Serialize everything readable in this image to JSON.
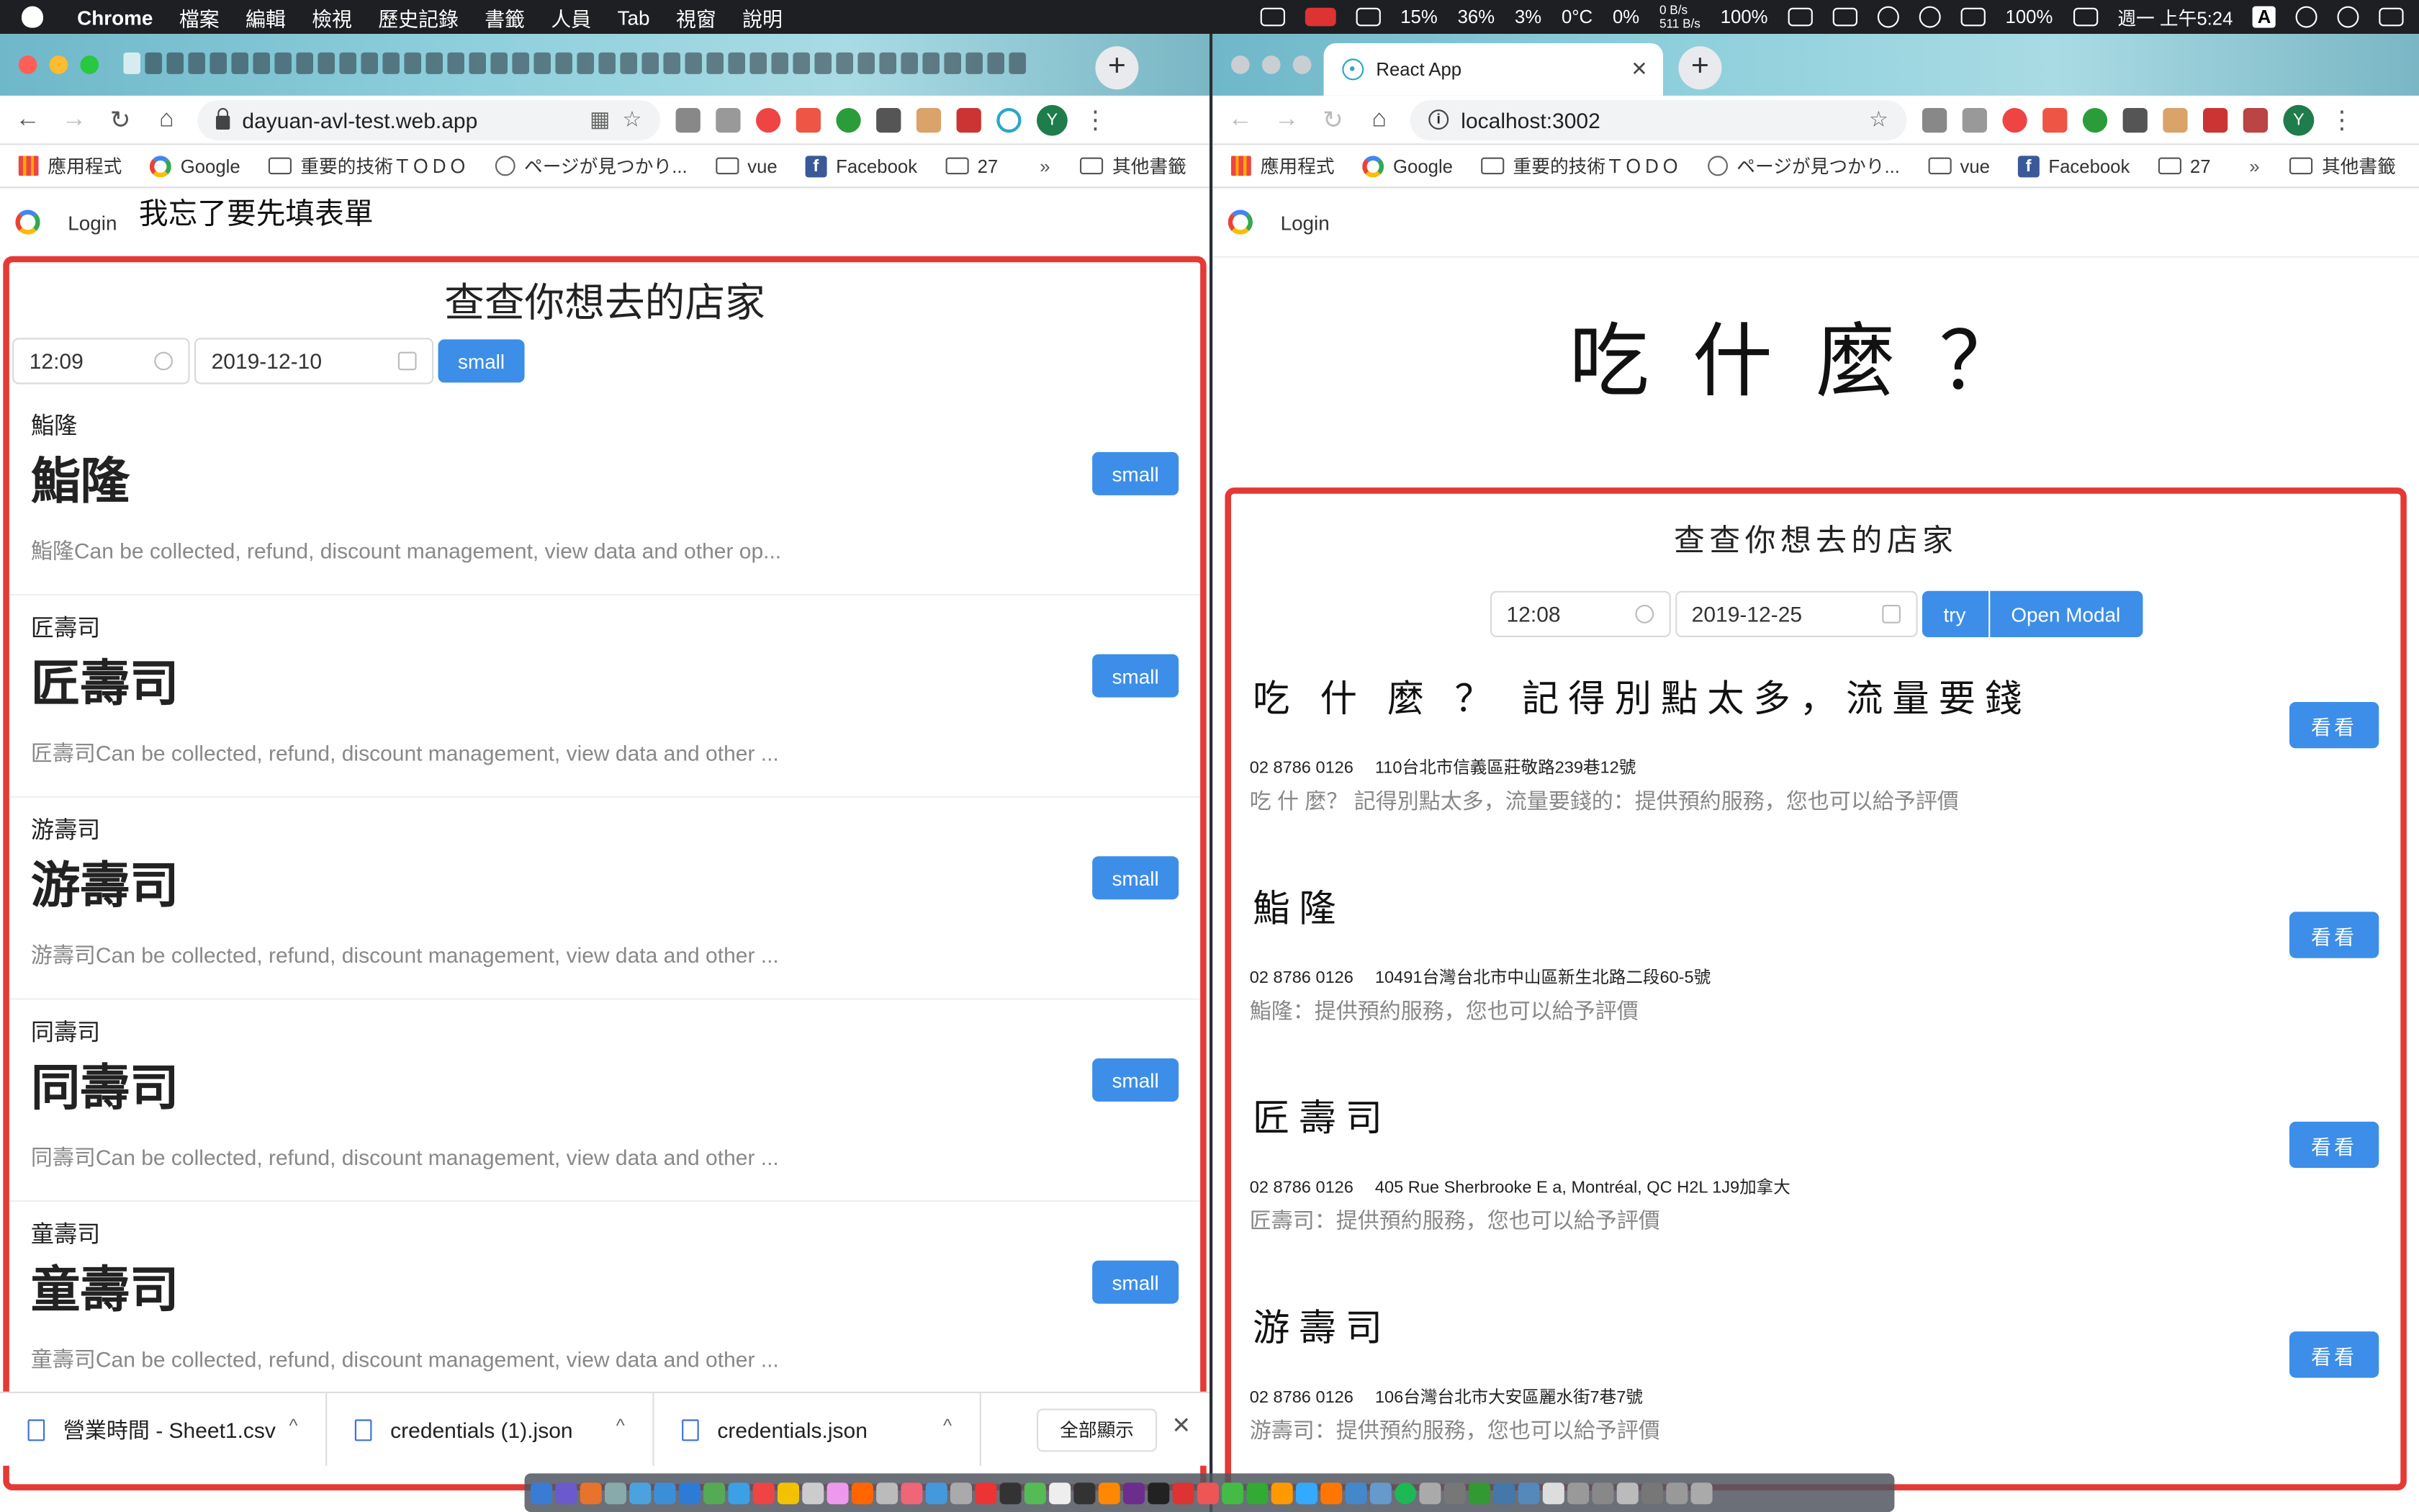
{
  "menubar": {
    "app": "Chrome",
    "items": [
      "檔案",
      "編輯",
      "檢視",
      "歷史記錄",
      "書籤",
      "人員",
      "Tab",
      "視窗",
      "說明"
    ],
    "status": [
      "15%",
      "36%",
      "3%",
      "0°C",
      "0%",
      "0 B/s",
      "511 B/s",
      "100%",
      "100%",
      "週一 上午5:24",
      "A"
    ]
  },
  "left_window": {
    "url": "dayuan-avl-test.web.app",
    "extension_avatar": "Y",
    "bookmarks": [
      "應用程式",
      "Google",
      "重要的技術ＴＯＤＯ",
      "ページが見つかり...",
      "vue",
      "Facebook",
      "27"
    ],
    "bookmarks_more": "»",
    "other_bookmarks": "其他書籤",
    "login": "Login",
    "note": "我忘了要先填表單",
    "panel_title": "查查你想去的店家",
    "time_value": "12:09",
    "date_value": "2019-12-10",
    "search_button": "small",
    "shops": [
      {
        "small": "鮨隆",
        "name": "鮨隆",
        "button": "small",
        "desc": "鮨隆Can be collected, refund, discount management, view data and other op..."
      },
      {
        "small": "匠壽司",
        "name": "匠壽司",
        "button": "small",
        "desc": "匠壽司Can be collected, refund, discount management, view data and other ..."
      },
      {
        "small": "游壽司",
        "name": "游壽司",
        "button": "small",
        "desc": "游壽司Can be collected, refund, discount management, view data and other ..."
      },
      {
        "small": "同壽司",
        "name": "同壽司",
        "button": "small",
        "desc": "同壽司Can be collected, refund, discount management, view data and other ..."
      },
      {
        "small": "童壽司",
        "name": "童壽司",
        "button": "small",
        "desc": "童壽司Can be collected, refund, discount management, view data and other ..."
      }
    ],
    "downloads": [
      "營業時間 - Sheet1.csv",
      "credentials (1).json",
      "credentials.json"
    ],
    "show_all": "全部顯示"
  },
  "right_window": {
    "tab_title": "React App",
    "url": "localhost:3002",
    "extension_avatar": "Y",
    "login": "Login",
    "big_title": "吃什麼？",
    "panel_title": "查查你想去的店家",
    "time_value": "12:08",
    "date_value": "2019-12-25",
    "try_button": "try",
    "modal_button": "Open Modal",
    "shops": [
      {
        "name": "吃 什 麼 ？ 記得別點太多，流量要錢",
        "phone": "02 8786 0126",
        "address": "110台北市信義區莊敬路239巷12號",
        "desc": "吃 什 麼？ 記得別點太多，流量要錢的：提供預約服務，您也可以給予評價",
        "button": "看看"
      },
      {
        "name": "鮨隆",
        "phone": "02 8786 0126",
        "address": "10491台灣台北市中山區新生北路二段60-5號",
        "desc": "鮨隆：提供預約服務，您也可以給予評價",
        "button": "看看"
      },
      {
        "name": "匠壽司",
        "phone": "02 8786 0126",
        "address": "405 Rue Sherbrooke E a, Montréal, QC H2L 1J9加拿大",
        "desc": "匠壽司：提供預約服務，您也可以給予評價",
        "button": "看看"
      },
      {
        "name": "游壽司",
        "phone": "02 8786 0126",
        "address": "106台灣台北市大安區麗水街7巷7號",
        "desc": "游壽司：提供預約服務，您也可以給予評價",
        "button": "看看"
      }
    ]
  },
  "colors": {
    "accent": "#3c8ee8",
    "panel_border": "#e53935"
  }
}
